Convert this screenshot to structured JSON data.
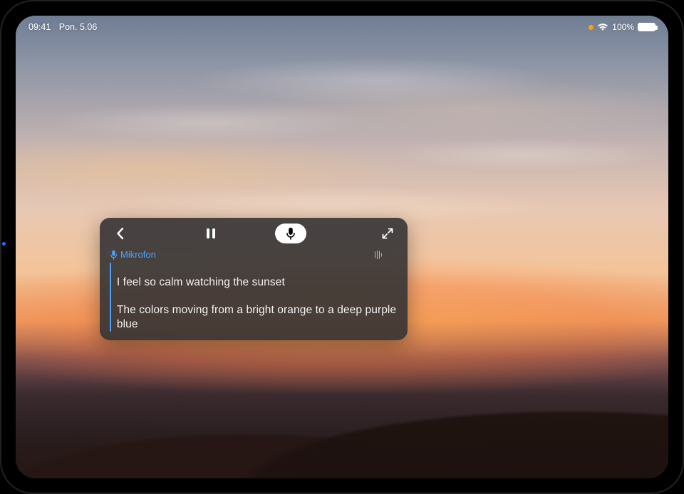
{
  "statusbar": {
    "time": "09:41",
    "date": "Pon. 5.06",
    "battery_text": "100%",
    "mic_active_color": "#ff9f0a"
  },
  "captions_panel": {
    "source_label": "Mikrofon",
    "transcript_line1": "I feel so calm watching the sunset",
    "transcript_line2": "The colors moving from a bright orange to a deep purple blue",
    "icons": {
      "back": "chevron-left",
      "pause": "pause",
      "mic": "microphone",
      "expand": "expand"
    },
    "accent_color": "#4aa3ff"
  }
}
